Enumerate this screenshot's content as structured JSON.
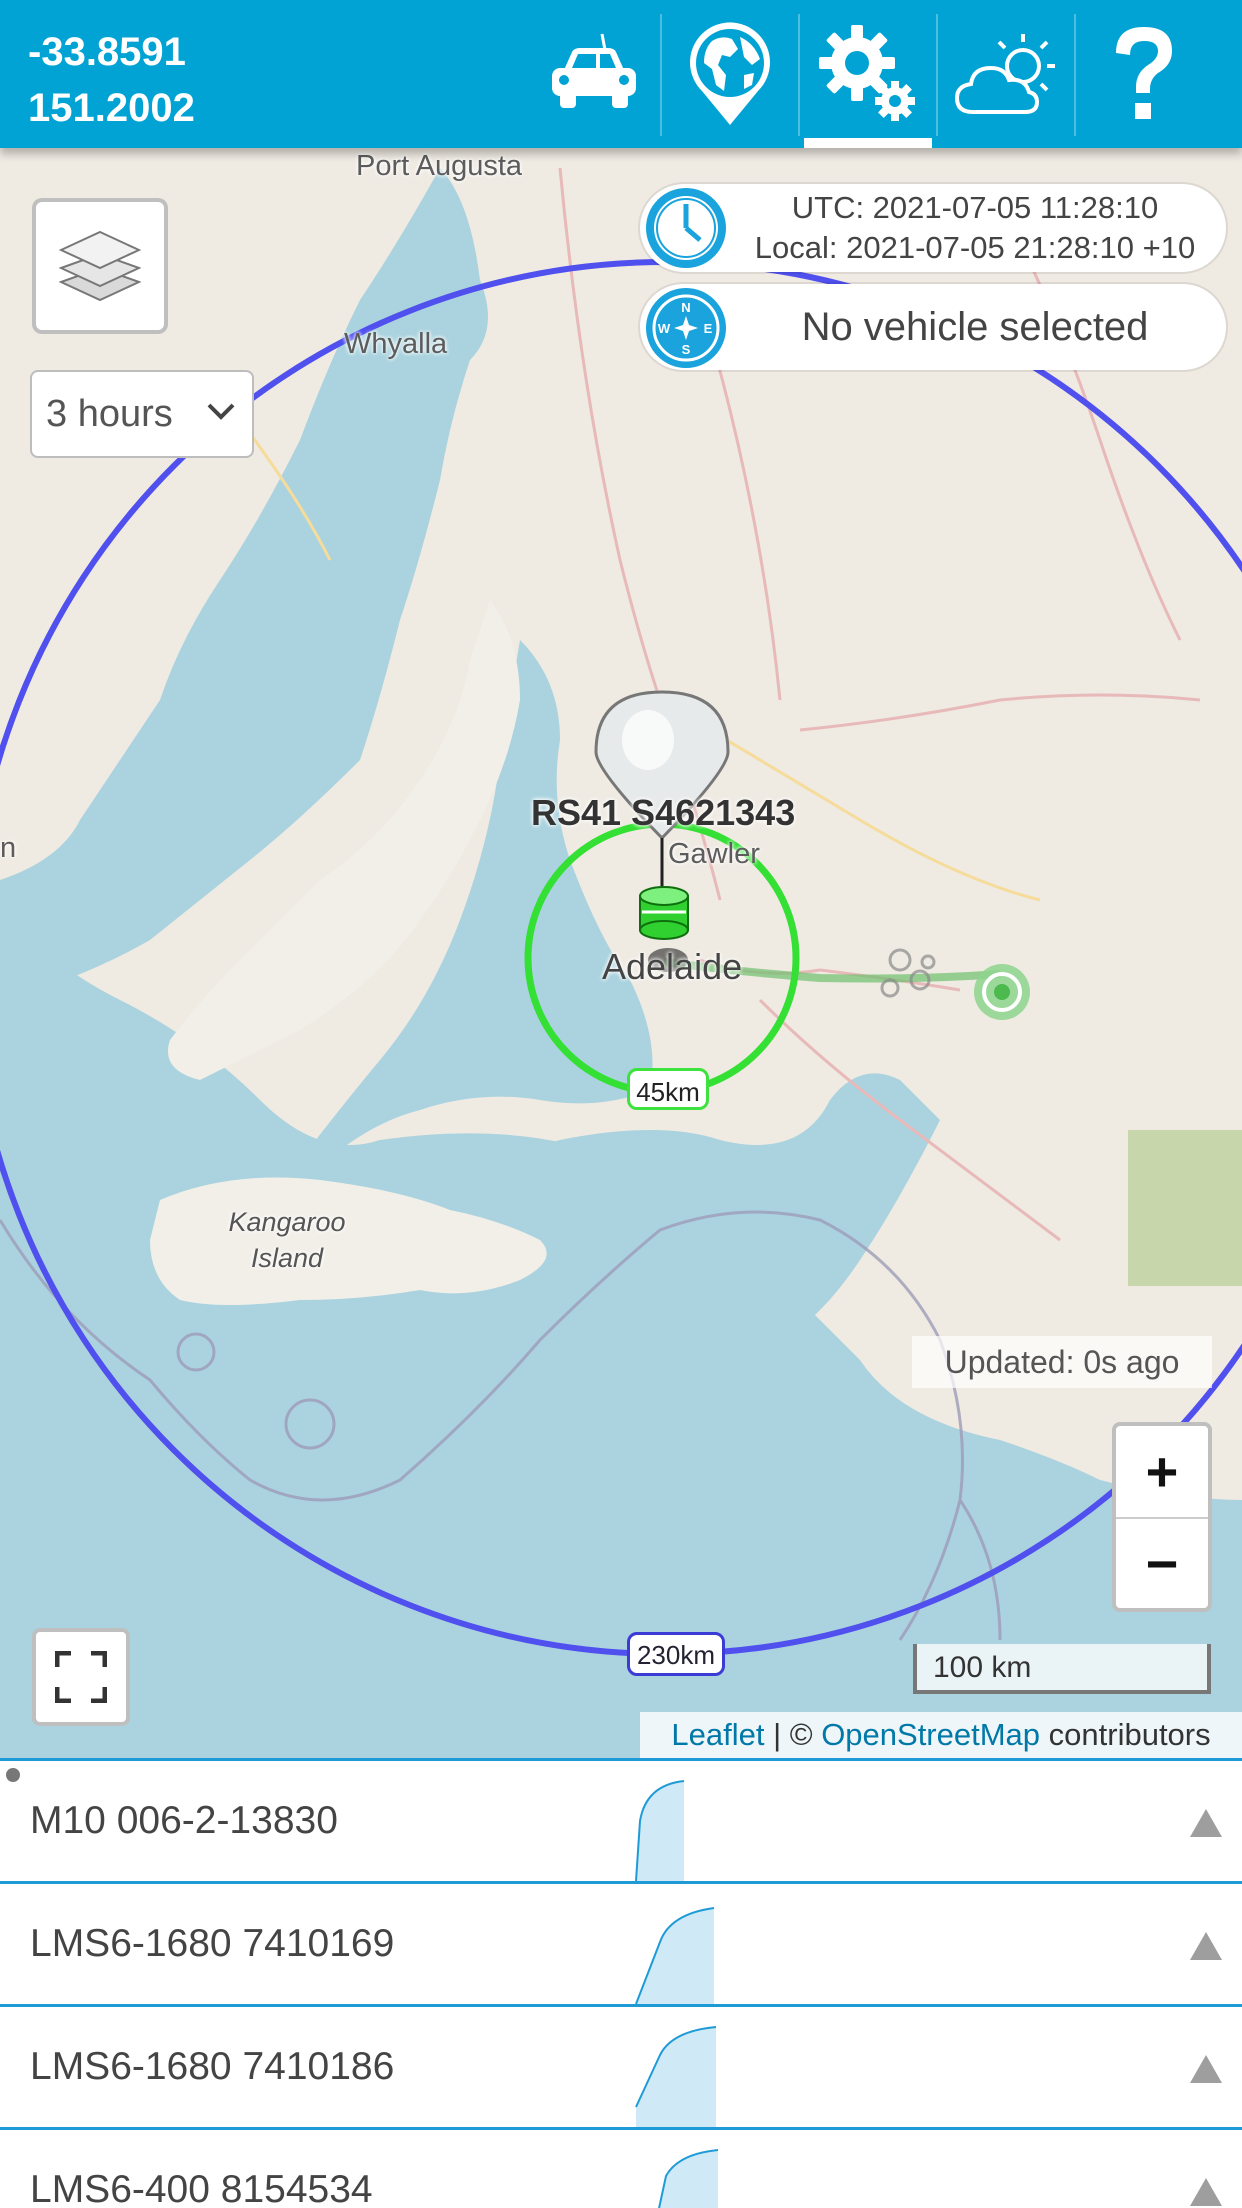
{
  "header": {
    "latitude": "-33.8591",
    "longitude": "151.2002",
    "nav": [
      {
        "name": "car-icon",
        "active": false
      },
      {
        "name": "globe-pin-icon",
        "active": false
      },
      {
        "name": "gears-icon",
        "active": true
      },
      {
        "name": "weather-icon",
        "active": false
      },
      {
        "name": "help-icon",
        "active": false
      }
    ],
    "accent_color": "#00a3d3"
  },
  "map": {
    "period_select": {
      "value": "3 hours"
    },
    "time": {
      "utc": "UTC: 2021-07-05 11:28:10",
      "local": "Local: 2021-07-05 21:28:10 +10"
    },
    "vehicle_status": "No vehicle selected",
    "labels": {
      "port_augusta": "Port Augusta",
      "whyalla": "Whyalla",
      "gawler": "Gawler",
      "adelaide": "Adelaide",
      "kangaroo_island_1": "Kangaroo",
      "kangaroo_island_2": "Island",
      "edge_n": "n"
    },
    "payload": "RS41 S4621343",
    "radius_small": "45km",
    "radius_large": "230km",
    "updated": "Updated: 0s ago",
    "zoom_in": "+",
    "zoom_out": "−",
    "scale": "100 km",
    "attribution": {
      "leaflet": "Leaflet",
      "sep": " | © ",
      "osm": "OpenStreetMap",
      "suffix": " contributors"
    }
  },
  "list": {
    "items": [
      {
        "name": "M10 006-2-13830"
      },
      {
        "name": "LMS6-1680 7410169"
      },
      {
        "name": "LMS6-1680 7410186"
      },
      {
        "name": "LMS6-400 8154534"
      }
    ]
  }
}
